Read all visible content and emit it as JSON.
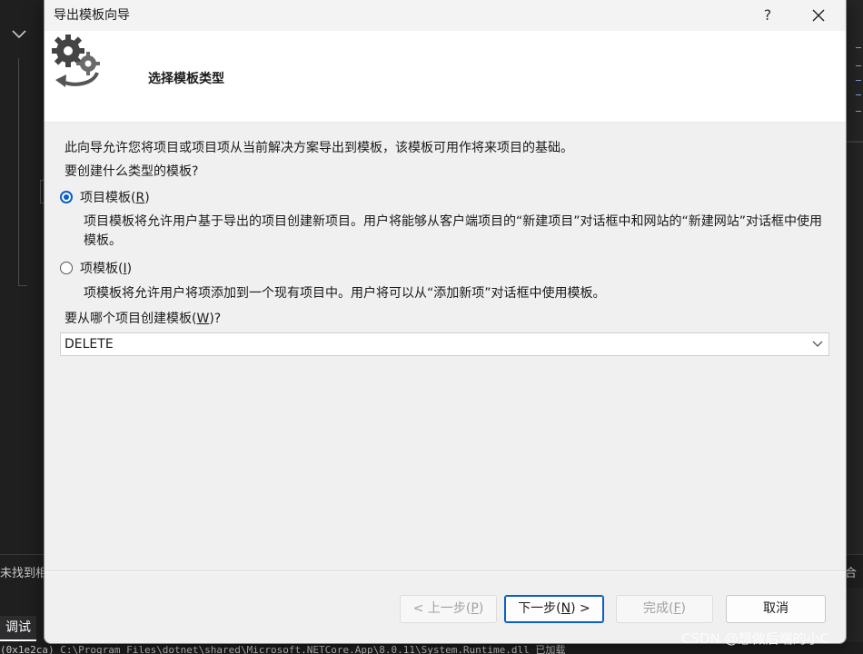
{
  "background": {
    "left_panel_text": "未找到相",
    "right_panel_text": "合",
    "tab_label": "调试",
    "console_text": "(0x1e2ca) C:\\Program Files\\dotnet\\shared\\Microsoft.NETCore.App\\8.0.11\\System.Runtime.dll 已加载",
    "watermark": "CSDN @想做后端的小C"
  },
  "dialog": {
    "title": "导出模板向导",
    "help_label": "?",
    "header_title": "选择模板类型",
    "intro": "此向导允许您将项目或项目项从当前解决方案导出到模板，该模板可用作将来项目的基础。",
    "question": "要创建什么类型的模板?",
    "options": [
      {
        "label": "项目模板(",
        "accel": "R",
        "label_end": ")",
        "checked": true,
        "description": "项目模板将允许用户基于导出的项目创建新项目。用户将能够从客户端项目的“新建项目”对话框中和网站的“新建网站”对话框中使用模板。"
      },
      {
        "label": "项模板(",
        "accel": "I",
        "label_end": ")",
        "checked": false,
        "description": "项模板将允许用户将项添加到一个现有项目中。用户将可以从“添加新项”对话框中使用模板。"
      }
    ],
    "project_question": "要从哪个项目创建模板(",
    "project_accel": "W",
    "project_question_end": ")?",
    "project_selected": "DELETE",
    "buttons": {
      "prev": "< 上一步(",
      "prev_accel": "P",
      "prev_end": ")",
      "next": "下一步(",
      "next_accel": "N",
      "next_end": ") >",
      "finish": "完成(",
      "finish_accel": "F",
      "finish_end": ")",
      "cancel": "取消"
    }
  },
  "colors": {
    "accent": "#0a5fc7",
    "dialog_bg": "#f0f0f0",
    "header_bg": "#ffffff",
    "ide_bg": "#1e1e1e"
  },
  "icons": [
    "gear-export-icon",
    "close-icon",
    "chevron-down-icon",
    "radio-checked",
    "radio-unchecked"
  ]
}
